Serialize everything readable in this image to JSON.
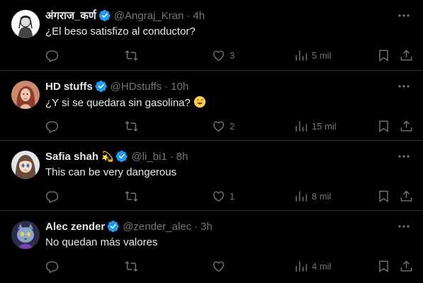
{
  "replies": [
    {
      "name": "अंगराज_कर्ण",
      "handle": "@Angraj_Kran",
      "separator": "·",
      "time": "4h",
      "text": "¿El beso satisfizo al conductor?",
      "reply_count": "",
      "retweet_count": "",
      "like_count": "3",
      "views": "5 mil",
      "avatar_icon": "sketch-portrait"
    },
    {
      "name": "HD stuffs",
      "handle": "@HDstuffs",
      "separator": "·",
      "time": "10h",
      "text": "¿Y si se quedara sin gasolina?",
      "text_emoji": "grinning-sweat-emoji",
      "reply_count": "",
      "retweet_count": "",
      "like_count": "2",
      "views": "15 mil",
      "avatar_icon": "woman-portrait"
    },
    {
      "name": "Safia shah",
      "name_emoji": "💫",
      "handle": "@li_bi1",
      "separator": "·",
      "time": "8h",
      "text": "This can be very dangerous",
      "reply_count": "",
      "retweet_count": "",
      "like_count": "1",
      "views": "8 mil",
      "avatar_icon": "cartoon-girl-portrait"
    },
    {
      "name": "Alec zender",
      "handle": "@zender_alec",
      "separator": "·",
      "time": "3h",
      "text": "No quedan más valores",
      "reply_count": "",
      "retweet_count": "",
      "like_count": "",
      "views": "4 mil",
      "avatar_icon": "cat-portrait"
    }
  ],
  "colors": {
    "background": "#000000",
    "text": "#e7e9ea",
    "muted": "#71767b",
    "divider": "#2f3336",
    "verified": "#1d9bf0"
  }
}
